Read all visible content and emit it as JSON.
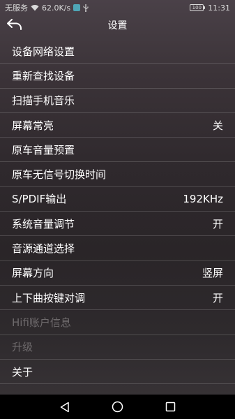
{
  "status_bar": {
    "carrier": "无服务",
    "speed": "62.0K/s",
    "battery": "100",
    "time": "11:31",
    "icons": [
      "wifi-icon",
      "app-badge-icon",
      "usb-icon",
      "battery-icon"
    ],
    "app_badge_color": "#4fa6b6"
  },
  "header": {
    "title": "设置",
    "back_icon": "back-arrow-icon"
  },
  "menu": {
    "items": [
      {
        "label": "设备网络设置",
        "value": ""
      },
      {
        "label": "重新查找设备",
        "value": ""
      },
      {
        "label": "扫描手机音乐",
        "value": ""
      },
      {
        "label": "屏幕常亮",
        "value": "关"
      },
      {
        "label": "原车音量预置",
        "value": ""
      },
      {
        "label": "原车无信号切换时间",
        "value": ""
      },
      {
        "label": "S/PDIF输出",
        "value": "192KHz"
      },
      {
        "label": "系统音量调节",
        "value": "开"
      },
      {
        "label": "音源通道选择",
        "value": ""
      },
      {
        "label": "屏幕方向",
        "value": "竖屏"
      },
      {
        "label": "上下曲按键对调",
        "value": "开"
      },
      {
        "label": "Hifi账户信息",
        "value": "",
        "disabled": true
      },
      {
        "label": "升级",
        "value": "",
        "disabled": true
      },
      {
        "label": "关于",
        "value": ""
      }
    ]
  },
  "nav_bar": {
    "icons": [
      "back-triangle-icon",
      "home-circle-icon",
      "recents-square-icon"
    ]
  }
}
